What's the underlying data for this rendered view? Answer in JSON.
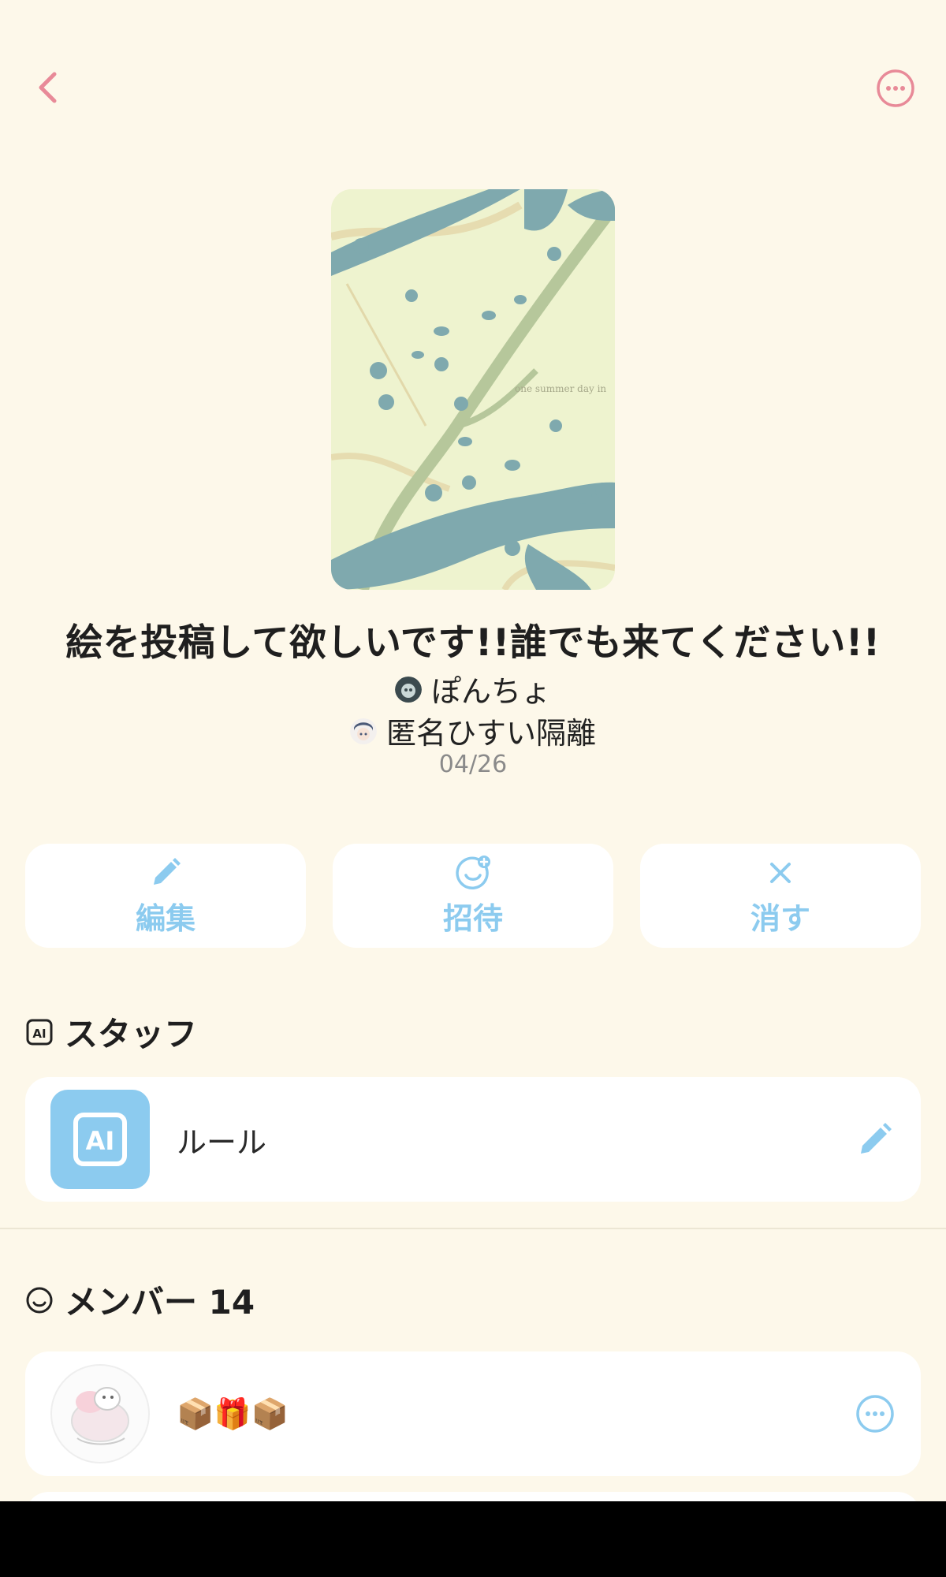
{
  "header": {
    "back_icon": "chevron-left-icon",
    "more_icon": "more-horizontal-circle-icon",
    "accent_color": "#e88a98"
  },
  "chat": {
    "cover_caption": "one summer day in",
    "title": "絵を投稿して欲しいです!!誰でも来てください!!",
    "owner_name": "ぽんちょ",
    "coowner_name": "匿名ひすい隔離",
    "date": "04/26"
  },
  "actions": {
    "edit_label": "編集",
    "invite_label": "招待",
    "delete_label": "消す",
    "color": "#8ccbef"
  },
  "staff": {
    "heading": "スタッフ",
    "items": [
      {
        "name": "ルール",
        "avatar_text": "AI",
        "avatar_color": "#8ccbef"
      }
    ]
  },
  "members": {
    "heading": "メンバー 14",
    "items": [
      {
        "name": "📦🎁📦"
      }
    ]
  }
}
